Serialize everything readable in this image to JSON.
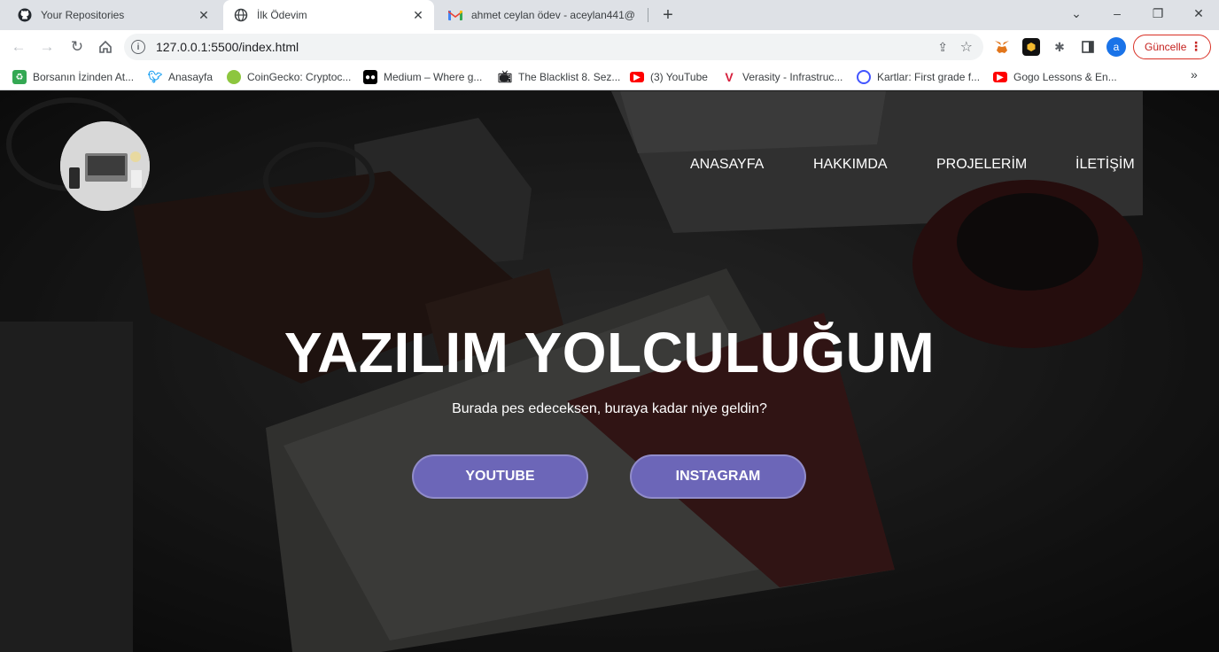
{
  "browser": {
    "tabs": [
      {
        "title": "Your Repositories",
        "icon": "github-icon",
        "active": false
      },
      {
        "title": "İlk Ödevim",
        "icon": "globe-icon",
        "active": true
      },
      {
        "title": "ahmet ceylan ödev - aceylan441@",
        "icon": "gmail-icon",
        "active": false
      }
    ],
    "new_tab_glyph": "+",
    "window": {
      "minimize": "⌄",
      "min": "–",
      "max": "❐",
      "close": "✕"
    },
    "url": "127.0.0.1:5500/index.html",
    "profile_initial": "a",
    "update_label": "Güncelle",
    "bookmarks": [
      {
        "label": "Borsanın İzinden At...",
        "icon": "recycle-icon",
        "color": "#34a853"
      },
      {
        "label": "Anasayfa",
        "icon": "twitter-icon",
        "color": "#1da1f2"
      },
      {
        "label": "CoinGecko: Cryptoc...",
        "icon": "coingecko-icon",
        "color": "#8dc63f"
      },
      {
        "label": "Medium – Where g...",
        "icon": "medium-icon",
        "color": "#000000"
      },
      {
        "label": "The Blacklist 8. Sez...",
        "icon": "tv-icon",
        "color": "#202124"
      },
      {
        "label": "(3) YouTube",
        "icon": "youtube-icon",
        "color": "#ff0000"
      },
      {
        "label": "Verasity - Infrastruc...",
        "icon": "verasity-icon",
        "color": "#d6203d"
      },
      {
        "label": "Kartlar: First grade f...",
        "icon": "quizlet-icon",
        "color": "#4255ff"
      },
      {
        "label": "Gogo Lessons & En...",
        "icon": "youtube-icon",
        "color": "#ff0000"
      }
    ]
  },
  "page": {
    "nav": [
      "ANASAYFA",
      "HAKKIMDA",
      "PROJELERİM",
      "İLETİŞİM"
    ],
    "hero_title": "YAZILIM YOLCULUĞUM",
    "hero_subtitle": "Burada pes edeceksen, buraya kadar niye geldin?",
    "buttons": [
      "YOUTUBE",
      "INSTAGRAM"
    ],
    "colors": {
      "button": "#6c66b8",
      "text": "#ffffff"
    }
  }
}
